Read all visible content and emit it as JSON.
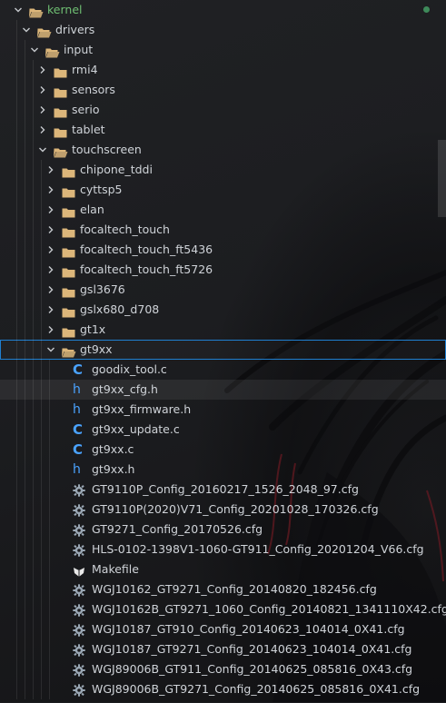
{
  "colors": {
    "folder": "#dcb67a",
    "accent": "#1f7fd0",
    "file_icon": "#4aa3ff",
    "root_label": "#6fbf73"
  },
  "tree": [
    {
      "label": "kernel",
      "depth": 0,
      "kind": "folder",
      "expanded": true,
      "root": true
    },
    {
      "label": "drivers",
      "depth": 1,
      "kind": "folder",
      "expanded": true
    },
    {
      "label": "input",
      "depth": 2,
      "kind": "folder",
      "expanded": true
    },
    {
      "label": "rmi4",
      "depth": 3,
      "kind": "folder",
      "expanded": false
    },
    {
      "label": "sensors",
      "depth": 3,
      "kind": "folder",
      "expanded": false
    },
    {
      "label": "serio",
      "depth": 3,
      "kind": "folder",
      "expanded": false
    },
    {
      "label": "tablet",
      "depth": 3,
      "kind": "folder",
      "expanded": false
    },
    {
      "label": "touchscreen",
      "depth": 3,
      "kind": "folder",
      "expanded": true
    },
    {
      "label": "chipone_tddi",
      "depth": 4,
      "kind": "folder",
      "expanded": false
    },
    {
      "label": "cyttsp5",
      "depth": 4,
      "kind": "folder",
      "expanded": false
    },
    {
      "label": "elan",
      "depth": 4,
      "kind": "folder",
      "expanded": false
    },
    {
      "label": "focaltech_touch",
      "depth": 4,
      "kind": "folder",
      "expanded": false
    },
    {
      "label": "focaltech_touch_ft5436",
      "depth": 4,
      "kind": "folder",
      "expanded": false
    },
    {
      "label": "focaltech_touch_ft5726",
      "depth": 4,
      "kind": "folder",
      "expanded": false
    },
    {
      "label": "gsl3676",
      "depth": 4,
      "kind": "folder",
      "expanded": false
    },
    {
      "label": "gslx680_d708",
      "depth": 4,
      "kind": "folder",
      "expanded": false
    },
    {
      "label": "gt1x",
      "depth": 4,
      "kind": "folder",
      "expanded": false
    },
    {
      "label": "gt9xx",
      "depth": 4,
      "kind": "folder",
      "expanded": true,
      "focused": true
    },
    {
      "label": "goodix_tool.c",
      "depth": 5,
      "kind": "c"
    },
    {
      "label": "gt9xx_cfg.h",
      "depth": 5,
      "kind": "h",
      "hover": true
    },
    {
      "label": "gt9xx_firmware.h",
      "depth": 5,
      "kind": "h"
    },
    {
      "label": "gt9xx_update.c",
      "depth": 5,
      "kind": "c"
    },
    {
      "label": "gt9xx.c",
      "depth": 5,
      "kind": "c"
    },
    {
      "label": "gt9xx.h",
      "depth": 5,
      "kind": "h"
    },
    {
      "label": "GT9110P_Config_20160217_1526_2048_97.cfg",
      "depth": 5,
      "kind": "cfg"
    },
    {
      "label": "GT9110P(2020)V71_Config_20201028_170326.cfg",
      "depth": 5,
      "kind": "cfg"
    },
    {
      "label": "GT9271_Config_20170526.cfg",
      "depth": 5,
      "kind": "cfg"
    },
    {
      "label": "HLS-0102-1398V1-1060-GT911_Config_20201204_V66.cfg",
      "depth": 5,
      "kind": "cfg"
    },
    {
      "label": "Makefile",
      "depth": 5,
      "kind": "make"
    },
    {
      "label": "WGJ10162_GT9271_Config_20140820_182456.cfg",
      "depth": 5,
      "kind": "cfg"
    },
    {
      "label": "WGJ10162B_GT9271_1060_Config_20140821_1341110X42.cfg",
      "depth": 5,
      "kind": "cfg"
    },
    {
      "label": "WGJ10187_GT910_Config_20140623_104014_0X41.cfg",
      "depth": 5,
      "kind": "cfg"
    },
    {
      "label": "WGJ10187_GT9271_Config_20140623_104014_0X41.cfg",
      "depth": 5,
      "kind": "cfg"
    },
    {
      "label": "WGJ89006B_GT911_Config_20140625_085816_0X43.cfg",
      "depth": 5,
      "kind": "cfg"
    },
    {
      "label": "WGJ89006B_GT9271_Config_20140625_085816_0X41.cfg",
      "depth": 5,
      "kind": "cfg"
    }
  ]
}
